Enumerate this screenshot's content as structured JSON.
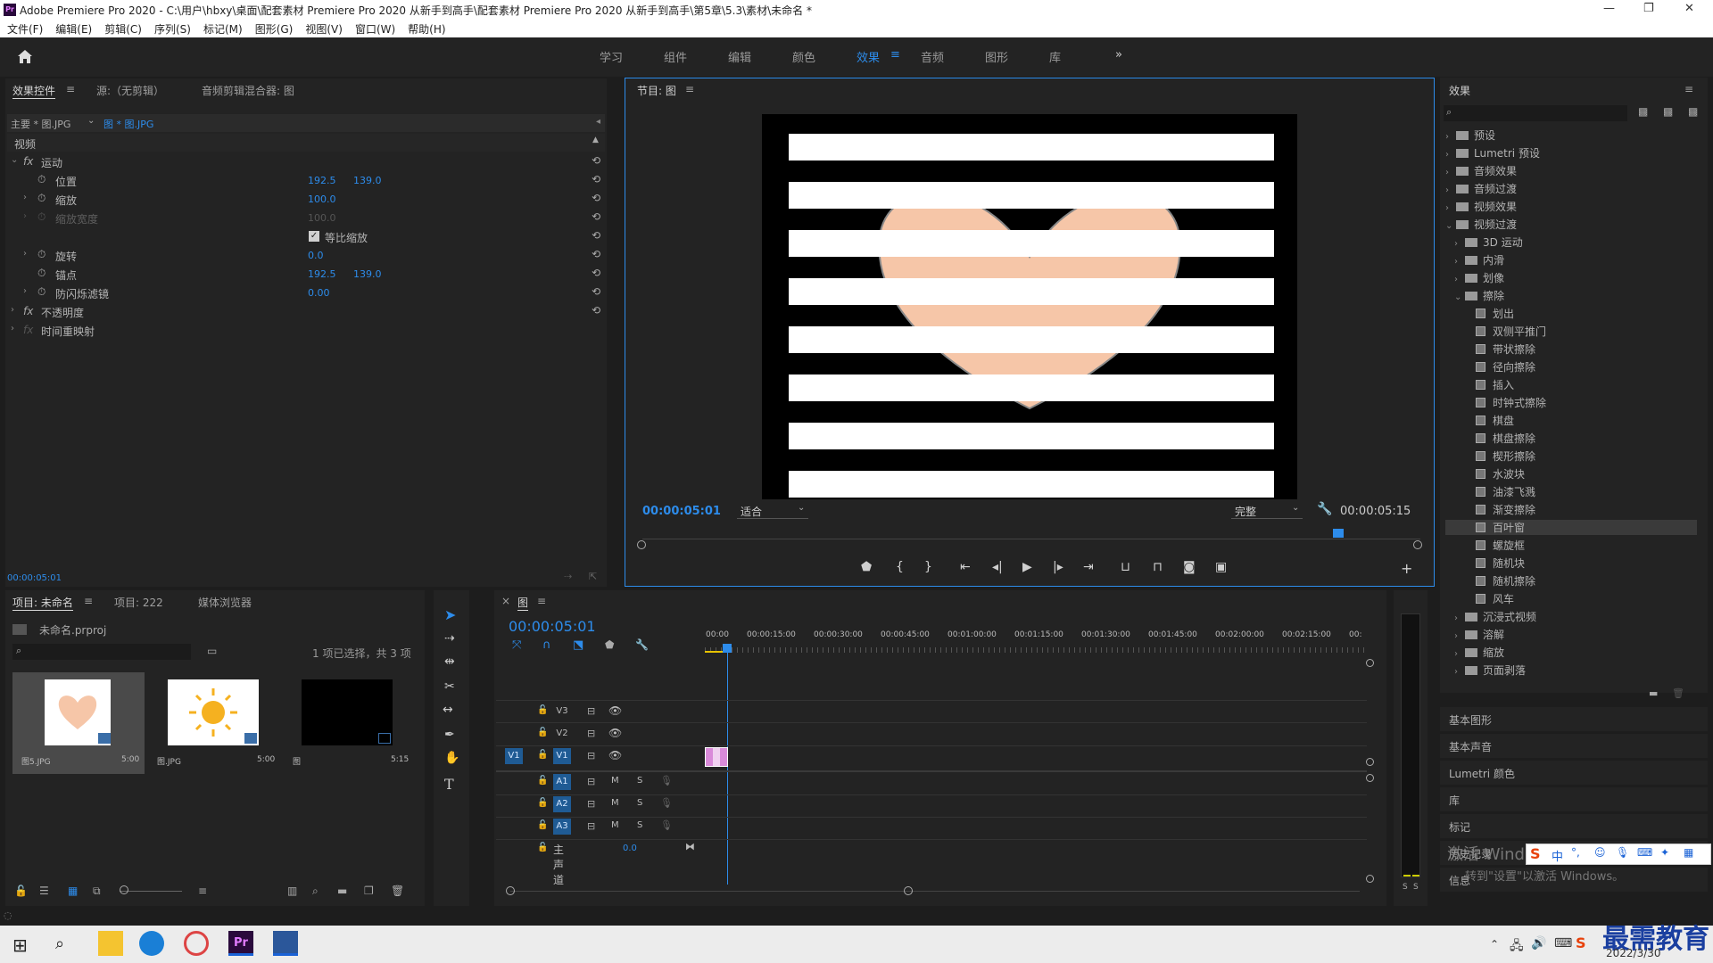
{
  "window": {
    "title": "Adobe Premiere Pro 2020 - C:\\用户\\hbxy\\桌面\\配套素材 Premiere Pro 2020 从新手到高手\\配套素材 Premiere Pro 2020 从新手到高手\\第5章\\5.3\\素材\\未命名 *",
    "app_badge": "Pr",
    "minimize": "—",
    "restore": "❐",
    "close": "✕"
  },
  "menu": [
    "文件(F)",
    "编辑(E)",
    "剪辑(C)",
    "序列(S)",
    "标记(M)",
    "图形(G)",
    "视图(V)",
    "窗口(W)",
    "帮助(H)"
  ],
  "workspaces": [
    "学习",
    "组件",
    "编辑",
    "颜色",
    "效果",
    "音频",
    "图形",
    "库"
  ],
  "workspaces_active": "效果",
  "workspace_menu_glyph": "≡",
  "workspaces_more": "»",
  "effect_controls": {
    "tabs": [
      "效果控件",
      "源:（无剪辑）",
      "音频剪辑混合器: 图"
    ],
    "tab_menu_glyph": "≡",
    "master_clip": "主要 * 图.JPG",
    "sequence_clip": "图 * 图.JPG",
    "section_video": "视频",
    "fx_glyph": "fx",
    "motion": "运动",
    "position_label": "位置",
    "position_x": "192.5",
    "position_y": "139.0",
    "scale_label": "缩放",
    "scale_value": "100.0",
    "scale_width_label": "缩放宽度",
    "scale_width_value": "100.0",
    "uniform_scale": "等比缩放",
    "rotation_label": "旋转",
    "rotation_value": "0.0",
    "anchor_label": "锚点",
    "anchor_x": "192.5",
    "anchor_y": "139.0",
    "antiflicker_label": "防闪烁滤镜",
    "antiflicker_value": "0.00",
    "opacity": "不透明度",
    "time_remap": "时间重映射",
    "timecode": "00:00:05:01"
  },
  "program_monitor": {
    "title": "节目: 图",
    "tab_menu_glyph": "≡",
    "timecode": "00:00:05:01",
    "fit": "适合",
    "quality": "完整",
    "duration": "00:00:05:15",
    "playhead_fraction": 0.9,
    "add_glyph": "+"
  },
  "project": {
    "tabs": [
      "项目: 未命名",
      "项目: 222",
      "媒体浏览器"
    ],
    "tab_menu_glyph": "≡",
    "file": "未命名.prproj",
    "selection": "1 项已选择，共 3 项",
    "items": [
      {
        "name": "图5.JPG",
        "duration": "5:00"
      },
      {
        "name": "图.JPG",
        "duration": "5:00"
      },
      {
        "name": "图",
        "duration": "5:15"
      }
    ]
  },
  "timeline": {
    "tab": "图",
    "close_glyph": "×",
    "tab_menu_glyph": "≡",
    "timecode": "00:00:05:01",
    "ruler": [
      "00:00",
      "00:00:15:00",
      "00:00:30:00",
      "00:00:45:00",
      "00:01:00:00",
      "00:01:15:00",
      "00:01:30:00",
      "00:01:45:00",
      "00:02:00:00",
      "00:02:15:00",
      "00:"
    ],
    "video_tracks": [
      "V3",
      "V2",
      "V1"
    ],
    "audio_tracks": [
      "A1",
      "A2",
      "A3"
    ],
    "source_patch": "V1",
    "mute": "M",
    "solo": "S",
    "master": "主声道",
    "master_value": "0.0",
    "meter_solo": "S"
  },
  "effects_panel": {
    "title": "效果",
    "tab_menu_glyph": "≡",
    "tree": [
      {
        "label": "预设",
        "level": 0,
        "kind": "folder",
        "open": false
      },
      {
        "label": "Lumetri 预设",
        "level": 0,
        "kind": "folder",
        "open": false
      },
      {
        "label": "音频效果",
        "level": 0,
        "kind": "folder",
        "open": false
      },
      {
        "label": "音频过渡",
        "level": 0,
        "kind": "folder",
        "open": false
      },
      {
        "label": "视频效果",
        "level": 0,
        "kind": "folder",
        "open": false
      },
      {
        "label": "视频过渡",
        "level": 0,
        "kind": "folder",
        "open": true
      },
      {
        "label": "3D 运动",
        "level": 1,
        "kind": "folder",
        "open": false
      },
      {
        "label": "内滑",
        "level": 1,
        "kind": "folder",
        "open": false
      },
      {
        "label": "划像",
        "level": 1,
        "kind": "folder",
        "open": false
      },
      {
        "label": "擦除",
        "level": 1,
        "kind": "folder",
        "open": true
      },
      {
        "label": "划出",
        "level": 2,
        "kind": "fx"
      },
      {
        "label": "双侧平推门",
        "level": 2,
        "kind": "fx"
      },
      {
        "label": "带状擦除",
        "level": 2,
        "kind": "fx"
      },
      {
        "label": "径向擦除",
        "level": 2,
        "kind": "fx"
      },
      {
        "label": "插入",
        "level": 2,
        "kind": "fx"
      },
      {
        "label": "时钟式擦除",
        "level": 2,
        "kind": "fx"
      },
      {
        "label": "棋盘",
        "level": 2,
        "kind": "fx"
      },
      {
        "label": "棋盘擦除",
        "level": 2,
        "kind": "fx"
      },
      {
        "label": "楔形擦除",
        "level": 2,
        "kind": "fx"
      },
      {
        "label": "水波块",
        "level": 2,
        "kind": "fx"
      },
      {
        "label": "油漆飞溅",
        "level": 2,
        "kind": "fx"
      },
      {
        "label": "渐变擦除",
        "level": 2,
        "kind": "fx"
      },
      {
        "label": "百叶窗",
        "level": 2,
        "kind": "fx",
        "selected": true
      },
      {
        "label": "螺旋框",
        "level": 2,
        "kind": "fx"
      },
      {
        "label": "随机块",
        "level": 2,
        "kind": "fx"
      },
      {
        "label": "随机擦除",
        "level": 2,
        "kind": "fx"
      },
      {
        "label": "风车",
        "level": 2,
        "kind": "fx"
      },
      {
        "label": "沉浸式视频",
        "level": 1,
        "kind": "folder",
        "open": false
      },
      {
        "label": "溶解",
        "level": 1,
        "kind": "folder",
        "open": false
      },
      {
        "label": "缩放",
        "level": 1,
        "kind": "folder",
        "open": false
      },
      {
        "label": "页面剥落",
        "level": 1,
        "kind": "folder",
        "open": false
      }
    ],
    "sections": [
      "基本图形",
      "基本声音",
      "Lumetri 颜色",
      "库",
      "标记",
      "历史记录",
      "信息"
    ]
  },
  "watermark": {
    "line1": "激活 Windows",
    "line2": "转到\"设置\"以激活 Windows。",
    "brand": "最需教育",
    "date": "2022/3/30",
    "ime": "中"
  },
  "colors": {
    "accent": "#2d8ceb",
    "heart": "#f6c6a8",
    "clip": "#d98ad9"
  }
}
